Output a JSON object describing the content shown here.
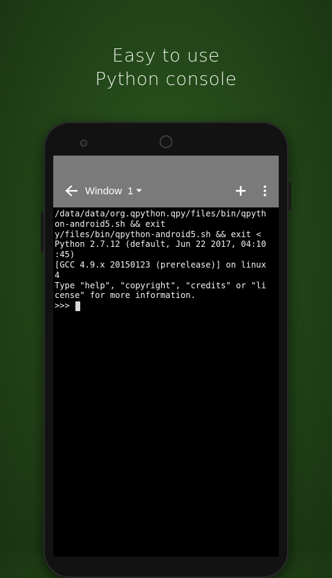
{
  "promo": {
    "headline_line1": "Easy to use",
    "headline_line2": "Python console"
  },
  "app": {
    "toolbar": {
      "back_icon": "arrow-left-icon",
      "window_label": "Window",
      "window_number": "1",
      "add_icon": "plus-icon",
      "more_icon": "more-vert-icon"
    },
    "terminal": {
      "lines": [
        "/data/data/org.qpython.qpy/files/bin/qpyth",
        "on-android5.sh && exit",
        "y/files/bin/qpython-android5.sh && exit <",
        "Python 2.7.12 (default, Jun 22 2017, 04:10",
        ":45)",
        "[GCC 4.9.x 20150123 (prerelease)] on linux",
        "4",
        "Type \"help\", \"copyright\", \"credits\" or \"li",
        "cense\" for more information."
      ],
      "prompt": ">>> "
    }
  },
  "colors": {
    "background": "#24481a",
    "toolbar": "#7a7a7a",
    "terminal_bg": "#000000",
    "terminal_text": "#f2f2f2"
  }
}
